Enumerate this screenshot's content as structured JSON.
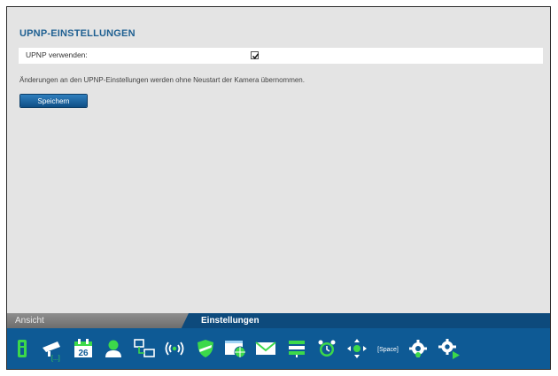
{
  "settings": {
    "title": "UPNP-EINSTELLUNGEN",
    "upnp_label": "UPNP verwenden:",
    "upnp_checked": true,
    "notice": "Änderungen an den UPNP-Einstellungen werden ohne Neustart der Kamera übernommen.",
    "save_label": "Speichern"
  },
  "tabs": {
    "ansicht": "Ansicht",
    "einstellungen": "Einstellungen",
    "active": "einstellungen"
  },
  "toolbar": {
    "icons": [
      "camera-info-icon",
      "network-camera-icon",
      "calendar-icon",
      "user-icon",
      "network-devices-icon",
      "wireless-icon",
      "security-shield-icon",
      "web-globe-icon",
      "email-icon",
      "storage-list-icon",
      "alarm-clock-icon",
      "ptz-navigation-icon",
      "space-key-icon",
      "settings-gear-icon",
      "settings-apply-icon"
    ],
    "calendar_day": "26",
    "ellipsis": "[...]",
    "space_label": "[Space]"
  },
  "colors": {
    "title_blue": "#1e5f91",
    "toolbar_bg": "#0e5a95",
    "tab_bg": "#0d4a7c",
    "icon_green": "#3cd94a",
    "icon_white": "#ffffff"
  }
}
